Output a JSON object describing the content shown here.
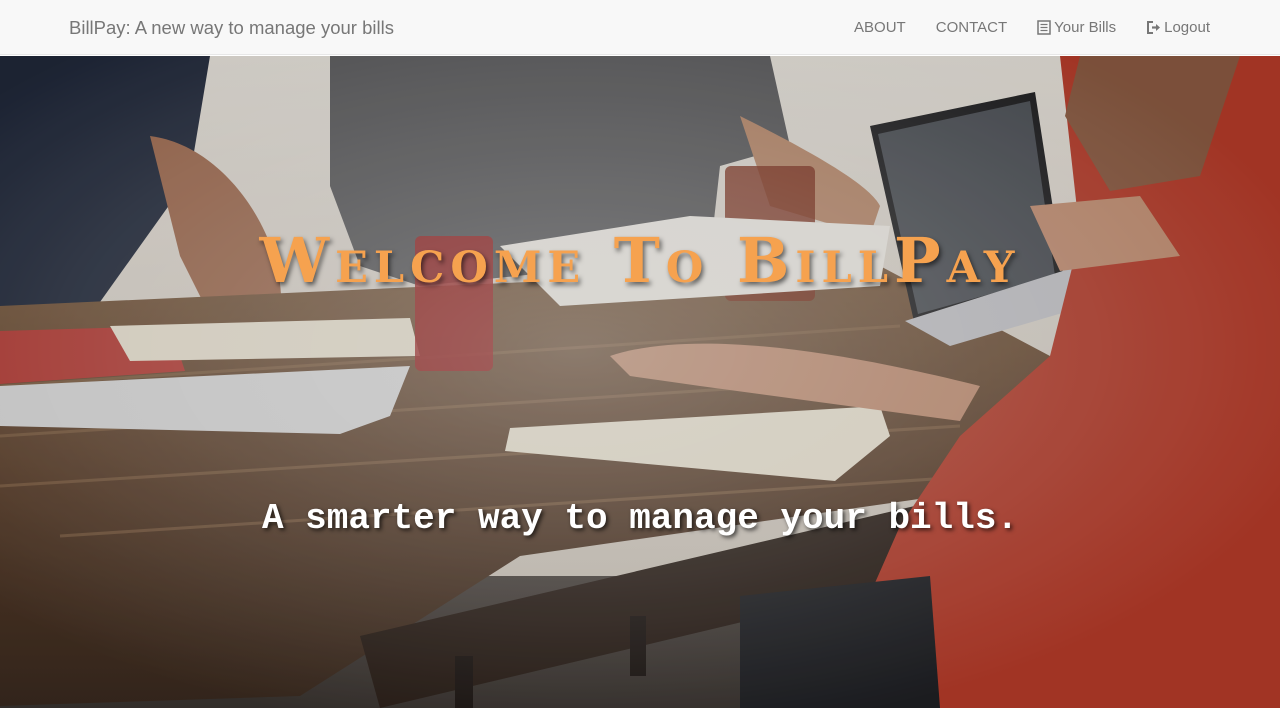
{
  "navbar": {
    "brand": "BillPay: A new way to manage your bills",
    "links": [
      {
        "label": "ABOUT",
        "icon": ""
      },
      {
        "label": "CONTACT",
        "icon": ""
      },
      {
        "label": "Your Bills",
        "icon": "list-alt-icon"
      },
      {
        "label": "Logout",
        "icon": "log-out-icon"
      }
    ]
  },
  "hero": {
    "title": "Welcome To BillPay",
    "tagline": "A smarter way to manage your bills.",
    "image": "photo of people working at a wooden table with laptops, notebooks and drinks",
    "title_color": "#f6a24f"
  }
}
